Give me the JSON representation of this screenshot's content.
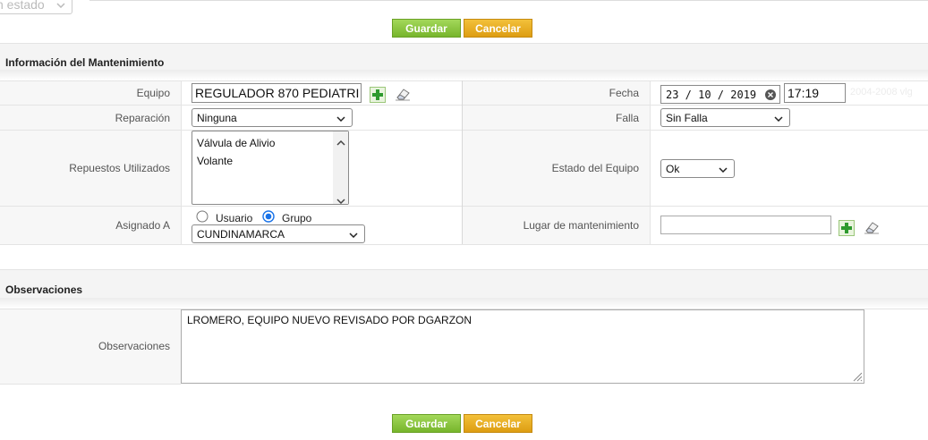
{
  "top": {
    "status_select": "n estado",
    "save_label": "Guardar",
    "cancel_label": "Cancelar"
  },
  "section_info": {
    "title": "Información del Mantenimiento",
    "equipo_label": "Equipo",
    "equipo_value": "REGULADOR 870 PEDIATRI",
    "fecha_label": "Fecha",
    "fecha_date": "23 / 10 / 2019",
    "fecha_time": "17:19",
    "ghost_text": "2004-2008 vlg",
    "reparacion_label": "Reparación",
    "reparacion_value": "Ninguna",
    "falla_label": "Falla",
    "falla_value": "Sin Falla",
    "repuestos_label": "Repuestos Utilizados",
    "repuestos_items": [
      "Válvula de Alivio",
      "Volante"
    ],
    "estado_label": "Estado del Equipo",
    "estado_value": "Ok",
    "asignado_label": "Asignado A",
    "radio_usuario": "Usuario",
    "radio_grupo": "Grupo",
    "asignado_value": "CUNDINAMARCA",
    "lugar_label": "Lugar de mantenimiento",
    "lugar_value": ""
  },
  "section_obs": {
    "title": "Observaciones",
    "obs_label": "Observaciones",
    "obs_value": "LROMERO, EQUIPO NUEVO REVISADO POR DGARZON"
  },
  "bottom": {
    "save_label": "Guardar",
    "cancel_label": "Cancelar"
  },
  "colors": {
    "save_green": "#8cc63f",
    "cancel_orange": "#e8a820",
    "section_bg": "#f4f4f4",
    "label_bg": "#f7f7f7"
  },
  "icons": [
    "add-icon",
    "eraser-icon",
    "clear-icon",
    "chevron-down-icon",
    "scroll-up-icon",
    "scroll-down-icon",
    "resize-grip-icon"
  ]
}
